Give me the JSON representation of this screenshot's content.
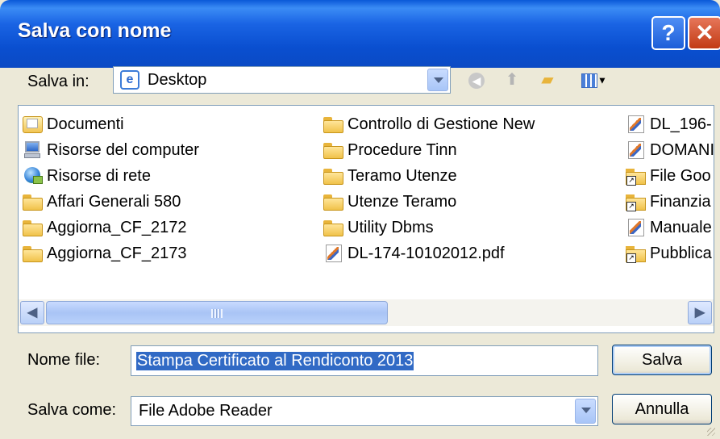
{
  "window": {
    "title": "Salva con nome"
  },
  "titlebar": {
    "help_label": "?",
    "close_label": "✕"
  },
  "location": {
    "label": "Salva in:",
    "value": "Desktop",
    "icons": [
      "back-icon",
      "up-folder-icon",
      "new-folder-icon",
      "views-menu-icon"
    ]
  },
  "files": {
    "col1": [
      {
        "name": "Documenti",
        "icon": "my-documents-icon"
      },
      {
        "name": "Risorse del computer",
        "icon": "my-computer-icon"
      },
      {
        "name": "Risorse di rete",
        "icon": "network-places-icon"
      },
      {
        "name": "Affari Generali 580",
        "icon": "folder-icon"
      },
      {
        "name": "Aggiorna_CF_2172",
        "icon": "folder-icon"
      },
      {
        "name": "Aggiorna_CF_2173",
        "icon": "folder-icon"
      }
    ],
    "col2": [
      {
        "name": "Controllo di Gestione New",
        "icon": "folder-icon"
      },
      {
        "name": "Procedure Tinn",
        "icon": "folder-icon"
      },
      {
        "name": "Teramo Utenze",
        "icon": "folder-icon"
      },
      {
        "name": "Utenze Teramo",
        "icon": "folder-icon"
      },
      {
        "name": "Utility Dbms",
        "icon": "folder-icon"
      },
      {
        "name": "DL-174-10102012.pdf",
        "icon": "pdf-icon"
      }
    ],
    "col3": [
      {
        "name": "DL_196-",
        "icon": "pdf-icon"
      },
      {
        "name": "DOMANI",
        "icon": "pdf-icon"
      },
      {
        "name": "File Goo",
        "icon": "folder-shortcut-icon"
      },
      {
        "name": "Finanzia",
        "icon": "folder-shortcut-icon"
      },
      {
        "name": "Manuale",
        "icon": "pdf-icon"
      },
      {
        "name": "Pubblica",
        "icon": "folder-shortcut-icon"
      }
    ]
  },
  "filename": {
    "label": "Nome file:",
    "value": "Stampa Certificato al Rendiconto 2013"
  },
  "filetype": {
    "label": "Salva come:",
    "value": "File Adobe Reader"
  },
  "buttons": {
    "save": "Salva",
    "cancel": "Annulla"
  },
  "colors": {
    "titlebar": "#0a4fd0",
    "selection": "#316ac5",
    "dialog_bg": "#ece9d8"
  }
}
